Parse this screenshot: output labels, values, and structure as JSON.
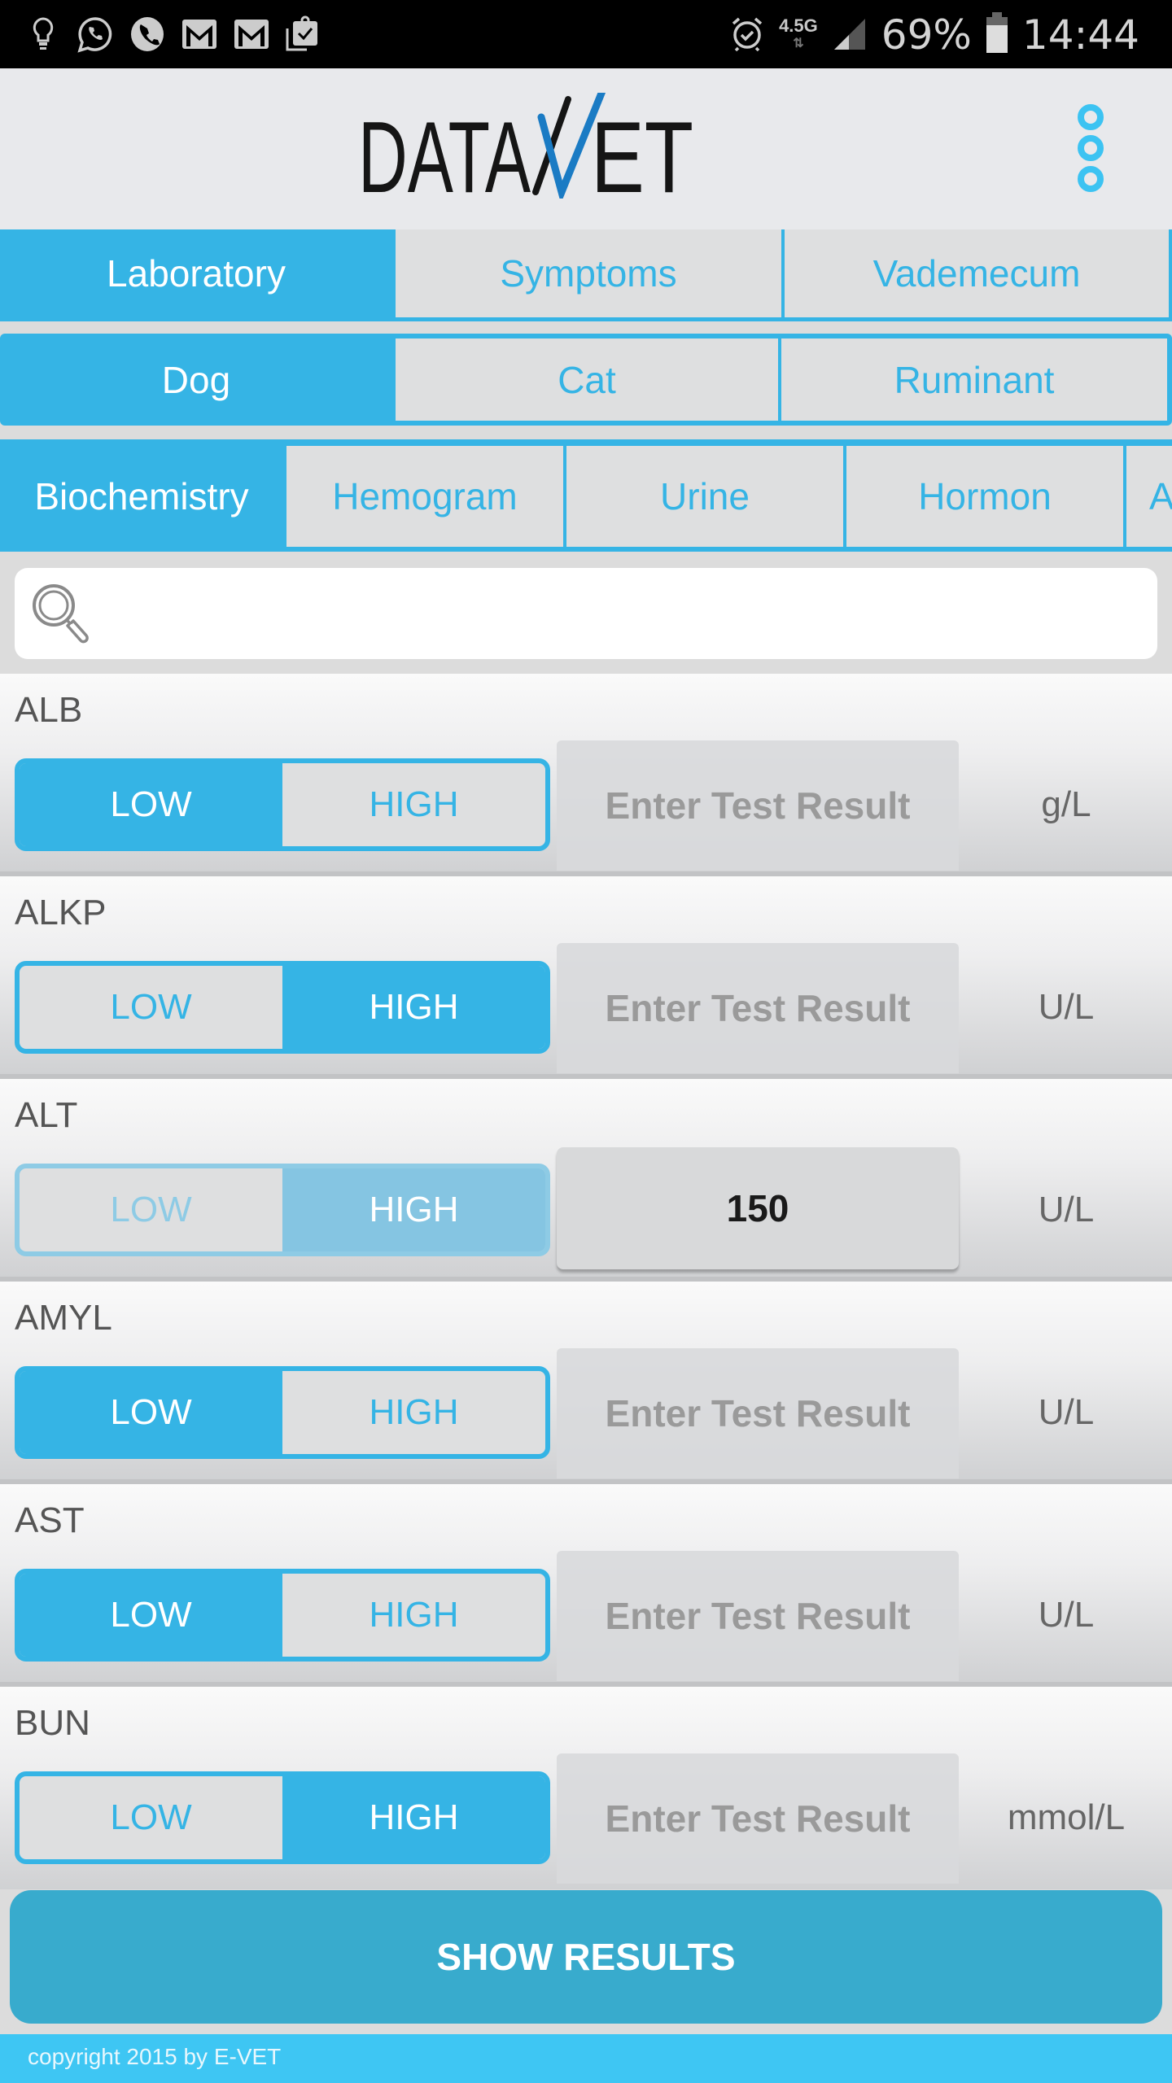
{
  "status_bar": {
    "notification_icons": [
      "lightbulb-icon",
      "whatsapp-icon",
      "phone-icon",
      "gmail-icon",
      "gmail-icon",
      "clipboard-check-icon"
    ],
    "alarm_icon": "alarm-icon",
    "network_type": "4.5G",
    "signal_icon": "signal-icon",
    "battery_percent": "69%",
    "time": "14:44"
  },
  "header": {
    "logo_text_left": "DATA",
    "logo_text_right": "ET",
    "logo_accent_color": "#1a7bc4",
    "menu_icon": "more-vert-icon"
  },
  "tabs": {
    "sections": [
      {
        "label": "Laboratory",
        "active": true
      },
      {
        "label": "Symptoms",
        "active": false
      },
      {
        "label": "Vademecum",
        "active": false
      }
    ],
    "species": [
      {
        "label": "Dog",
        "active": true
      },
      {
        "label": "Cat",
        "active": false
      },
      {
        "label": "Ruminant",
        "active": false
      }
    ],
    "categories": [
      {
        "label": "Biochemistry",
        "active": true
      },
      {
        "label": "Hemogram",
        "active": false
      },
      {
        "label": "Urine",
        "active": false
      },
      {
        "label": "Hormon",
        "active": false
      },
      {
        "label": "A",
        "active": false
      }
    ]
  },
  "search": {
    "placeholder": "",
    "value": ""
  },
  "tests": [
    {
      "name": "ALB",
      "low": "LOW",
      "high": "HIGH",
      "selected": "low",
      "disabled": false,
      "placeholder": "Enter Test Result",
      "value": "",
      "unit": "g/L"
    },
    {
      "name": "ALKP",
      "low": "LOW",
      "high": "HIGH",
      "selected": "high",
      "disabled": false,
      "placeholder": "Enter Test Result",
      "value": "",
      "unit": "U/L"
    },
    {
      "name": "ALT",
      "low": "LOW",
      "high": "HIGH",
      "selected": "high",
      "disabled": true,
      "placeholder": "Enter Test Result",
      "value": "150",
      "unit": "U/L"
    },
    {
      "name": "AMYL",
      "low": "LOW",
      "high": "HIGH",
      "selected": "low",
      "disabled": false,
      "placeholder": "Enter Test Result",
      "value": "",
      "unit": "U/L"
    },
    {
      "name": "AST",
      "low": "LOW",
      "high": "HIGH",
      "selected": "low",
      "disabled": false,
      "placeholder": "Enter Test Result",
      "value": "",
      "unit": "U/L"
    },
    {
      "name": "BUN",
      "low": "LOW",
      "high": "HIGH",
      "selected": "high",
      "disabled": false,
      "placeholder": "Enter Test Result",
      "value": "",
      "unit": "mmol/L"
    }
  ],
  "actions": {
    "show_results_label": "SHOW RESULTS"
  },
  "footer": {
    "copyright": "copyright 2015 by E-VET"
  },
  "colors": {
    "accent": "#35b4e5",
    "button": "#38abcd",
    "footer": "#3ec6f3",
    "tab_inactive_bg": "#dedfe0"
  }
}
